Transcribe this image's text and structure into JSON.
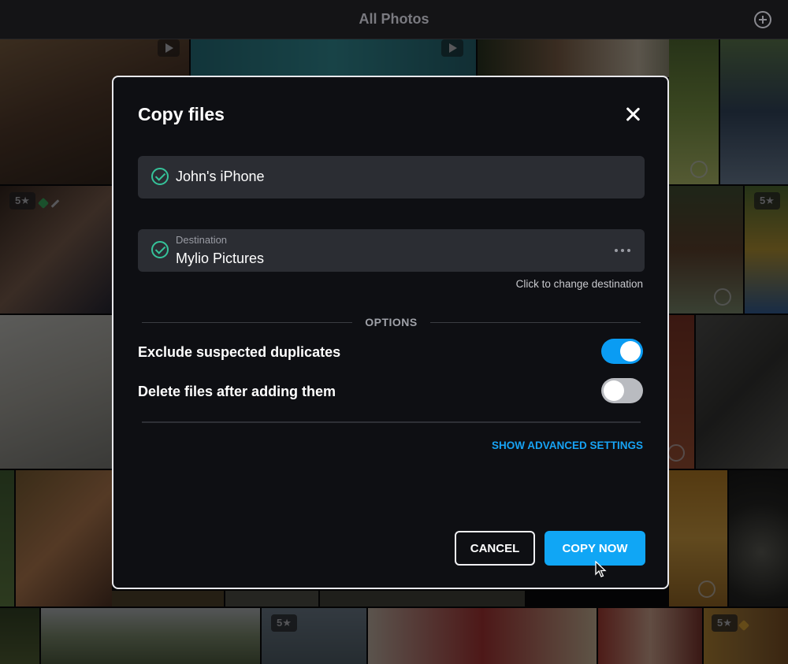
{
  "topbar": {
    "title": "All Photos"
  },
  "grid": {
    "badges": [
      "5★",
      "5★",
      "5★",
      "5★"
    ]
  },
  "dialog": {
    "title": "Copy files",
    "source": {
      "value": "John's iPhone"
    },
    "destination": {
      "label": "Destination",
      "value": "Mylio Pictures",
      "hint": "Click to change destination"
    },
    "options_header": "OPTIONS",
    "options": [
      {
        "label": "Exclude suspected duplicates",
        "enabled": true
      },
      {
        "label": "Delete files after adding them",
        "enabled": false
      }
    ],
    "advanced_link": "SHOW ADVANCED SETTINGS",
    "buttons": {
      "cancel": "CANCEL",
      "copy": "COPY NOW"
    }
  },
  "colors": {
    "accent": "#10a6f5",
    "toggle_on": "#0a9cf3",
    "success": "#35c39a",
    "link": "#17a3f4"
  }
}
